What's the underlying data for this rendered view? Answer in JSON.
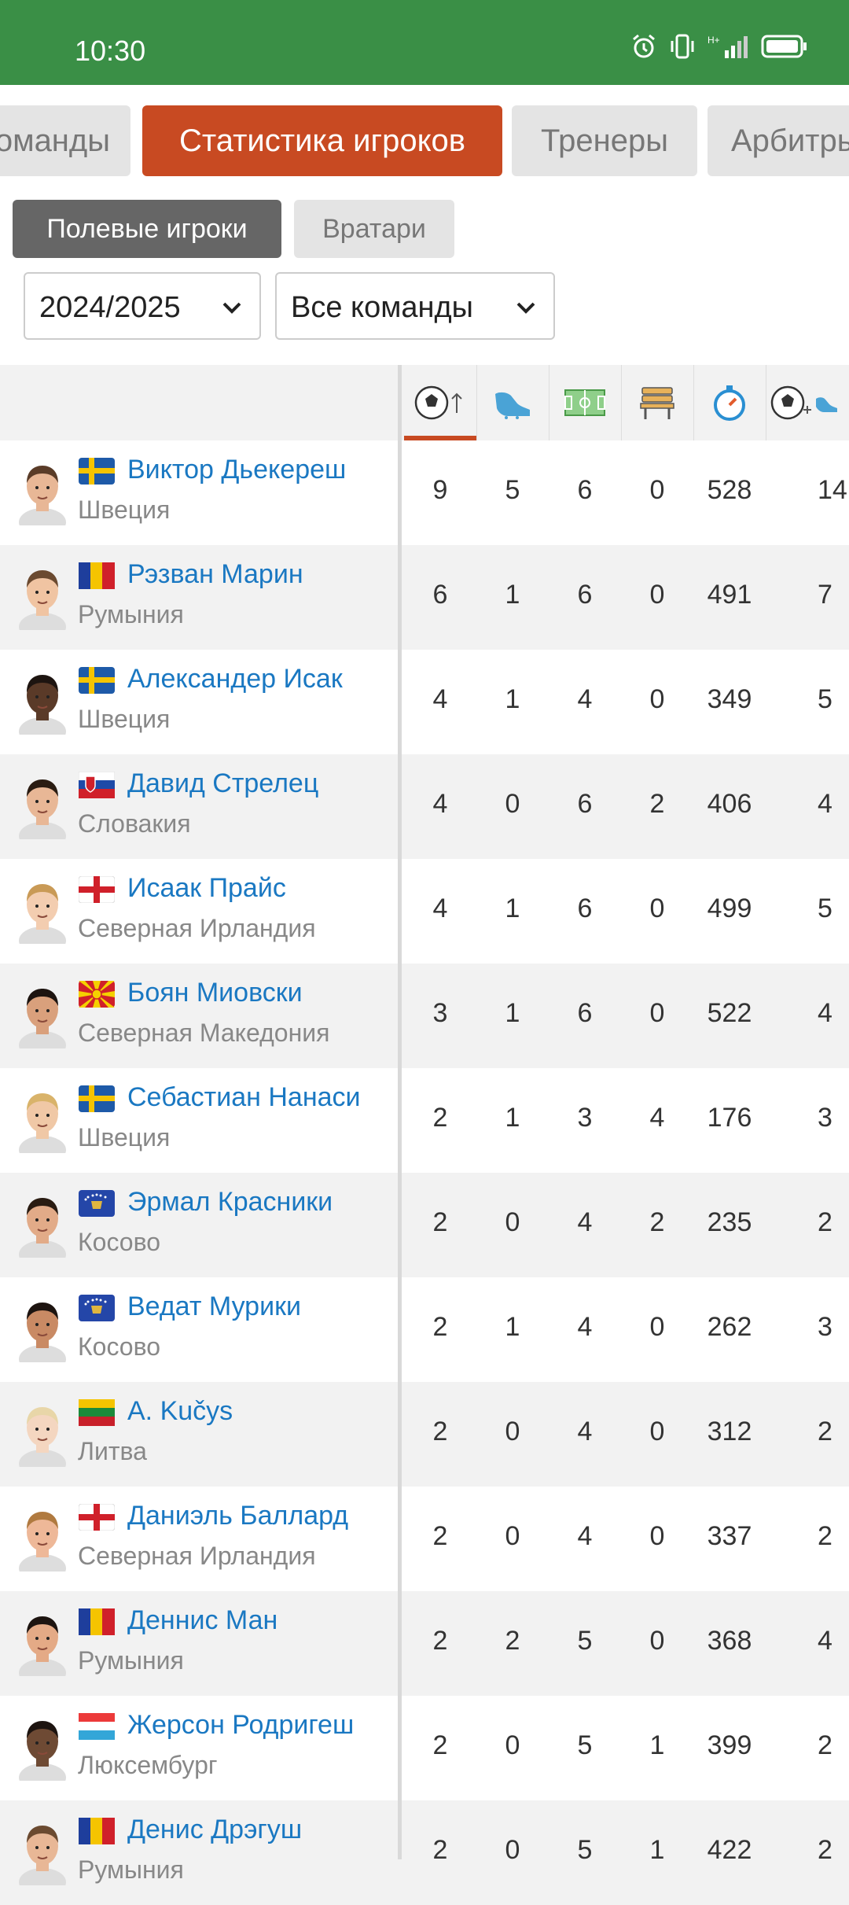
{
  "status": {
    "time": "10:30"
  },
  "tabs": [
    {
      "label": "Команды"
    },
    {
      "label": "Статистика игроков"
    },
    {
      "label": "Тренеры"
    },
    {
      "label": "Арбитры"
    }
  ],
  "subtabs": [
    {
      "label": "Полевые игроки"
    },
    {
      "label": "Вратари"
    }
  ],
  "filters": {
    "season": "2024/2025",
    "team": "Все команды"
  },
  "columns": [
    {
      "icon": "goals-sort-icon"
    },
    {
      "icon": "assists-boot-icon"
    },
    {
      "icon": "matches-pitch-icon"
    },
    {
      "icon": "bench-icon"
    },
    {
      "icon": "minutes-stopwatch-icon"
    },
    {
      "icon": "goals-plus-assists-icon"
    }
  ],
  "players": [
    {
      "name": "Виктор Дьекереш",
      "country": "Швеция",
      "flag": "sweden",
      "stats": [
        "9",
        "5",
        "6",
        "0",
        "528",
        "14"
      ]
    },
    {
      "name": "Рэзван Марин",
      "country": "Румыния",
      "flag": "romania",
      "stats": [
        "6",
        "1",
        "6",
        "0",
        "491",
        "7"
      ]
    },
    {
      "name": "Александер Исак",
      "country": "Швеция",
      "flag": "sweden",
      "stats": [
        "4",
        "1",
        "4",
        "0",
        "349",
        "5"
      ]
    },
    {
      "name": "Давид Стрелец",
      "country": "Словакия",
      "flag": "slovakia",
      "stats": [
        "4",
        "0",
        "6",
        "2",
        "406",
        "4"
      ]
    },
    {
      "name": "Исаак Прайс",
      "country": "Северная Ирландия",
      "flag": "northern-ireland",
      "stats": [
        "4",
        "1",
        "6",
        "0",
        "499",
        "5"
      ]
    },
    {
      "name": "Боян Миовски",
      "country": "Северная Македония",
      "flag": "north-macedonia",
      "stats": [
        "3",
        "1",
        "6",
        "0",
        "522",
        "4"
      ]
    },
    {
      "name": "Себастиан Нанаси",
      "country": "Швеция",
      "flag": "sweden",
      "stats": [
        "2",
        "1",
        "3",
        "4",
        "176",
        "3"
      ]
    },
    {
      "name": "Эрмал Красники",
      "country": "Косово",
      "flag": "kosovo",
      "stats": [
        "2",
        "0",
        "4",
        "2",
        "235",
        "2"
      ]
    },
    {
      "name": "Ведат Мурики",
      "country": "Косово",
      "flag": "kosovo",
      "stats": [
        "2",
        "1",
        "4",
        "0",
        "262",
        "3"
      ]
    },
    {
      "name": "A. Kučys",
      "country": "Литва",
      "flag": "lithuania",
      "stats": [
        "2",
        "0",
        "4",
        "0",
        "312",
        "2"
      ]
    },
    {
      "name": "Даниэль Баллард",
      "country": "Северная Ирландия",
      "flag": "northern-ireland",
      "stats": [
        "2",
        "0",
        "4",
        "0",
        "337",
        "2"
      ]
    },
    {
      "name": "Деннис Ман",
      "country": "Румыния",
      "flag": "romania",
      "stats": [
        "2",
        "2",
        "5",
        "0",
        "368",
        "4"
      ]
    },
    {
      "name": "Жерсон Родригеш",
      "country": "Люксембург",
      "flag": "luxembourg",
      "stats": [
        "2",
        "0",
        "5",
        "1",
        "399",
        "2"
      ]
    },
    {
      "name": "Денис Дрэгуш",
      "country": "Румыния",
      "flag": "romania",
      "stats": [
        "2",
        "0",
        "5",
        "1",
        "422",
        "2"
      ]
    }
  ],
  "colors": {
    "accent": "#c84a22",
    "statusbar": "#3a8f46",
    "link": "#1a78c2"
  }
}
